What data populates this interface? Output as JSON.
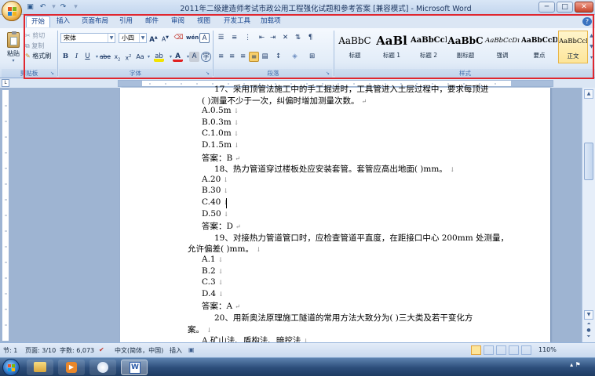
{
  "window": {
    "title": "2011年二级建造师考试市政公用工程强化试题和参考答案 [兼容模式] - Microsoft Word",
    "min": "─",
    "max": "□",
    "close": "✕"
  },
  "quick_access": {
    "save_icon": "save-icon",
    "undo_icon": "undo-icon",
    "redo_icon": "redo-icon"
  },
  "tabs": [
    "开始",
    "插入",
    "页面布局",
    "引用",
    "邮件",
    "审阅",
    "视图",
    "开发工具",
    "加载项"
  ],
  "ribbon": {
    "clipboard": {
      "label": "剪贴板",
      "paste": "粘贴",
      "cut": "剪切",
      "copy": "复制",
      "format_painter": "格式刷"
    },
    "font": {
      "label": "字体",
      "font_name": "宋体",
      "font_size": "小四"
    },
    "paragraph": {
      "label": "段落"
    },
    "styles": {
      "label": "样式",
      "items": [
        {
          "preview": "AaBbC",
          "name": "标题"
        },
        {
          "preview": "AaBl",
          "name": "标题 1"
        },
        {
          "preview": "AaBbCcI",
          "name": "标题 2"
        },
        {
          "preview": "AaBbC",
          "name": "副标题"
        },
        {
          "preview": "AaBbCcDı",
          "name": "强调"
        },
        {
          "preview": "AaBbCcD",
          "name": "要点"
        },
        {
          "preview": "AaBbCcDı",
          "name": "正文"
        }
      ]
    }
  },
  "document": {
    "lines": [
      {
        "text": "17、采用顶管法施工中的手工掘进时，工具管进入土层过程中，要求每顶进",
        "mark": ""
      },
      {
        "text": "(   )测量不少于一次，纠偏时增加测量次数。",
        "mark": "↵"
      },
      {
        "text": "A.0.5m",
        "mark": "↓"
      },
      {
        "text": "B.0.3m",
        "mark": "↓"
      },
      {
        "text": "C.1.0m",
        "mark": "↓"
      },
      {
        "text": "D.1.5m",
        "mark": "↓"
      },
      {
        "text": "答案：B",
        "mark": "↵"
      },
      {
        "text": "18、热力管道穿过楼板处应安装套管。套管应高出地面(  )mm。",
        "mark": "↓"
      },
      {
        "text": "A.20",
        "mark": "↓"
      },
      {
        "text": "B.30",
        "mark": "↓"
      },
      {
        "text": "C.40",
        "mark": "↓"
      },
      {
        "text": "D.50",
        "mark": "↓"
      },
      {
        "text": "答案：D",
        "mark": "↵"
      },
      {
        "text": "19、对接热力管道管口时，应检查管道平直度，在距接口中心 200mm 处测量，",
        "mark": ""
      },
      {
        "text": "允许偏差(  )mm。",
        "mark": "↓"
      },
      {
        "text": "A.1",
        "mark": "↓"
      },
      {
        "text": "B.2",
        "mark": "↓"
      },
      {
        "text": "C.3",
        "mark": "↓"
      },
      {
        "text": "D.4",
        "mark": "↓"
      },
      {
        "text": "答案：A",
        "mark": "↵"
      },
      {
        "text": "20、用新奥法原理施工隧道的常用方法大致分为(  )三大类及若干变化方",
        "mark": ""
      },
      {
        "text": "案。",
        "mark": "↓"
      },
      {
        "text": "A.矿山法、盾构法、暗挖法",
        "mark": "↓"
      }
    ]
  },
  "status": {
    "section": "节: 1",
    "page": "页面: 3/10",
    "words": "字数: 6,073",
    "language": "中文(简体，中国)",
    "mode": "插入",
    "zoom": "110%"
  },
  "colors": {
    "highlight_box": "#e0272f",
    "ribbon": "#dbe6f4"
  }
}
